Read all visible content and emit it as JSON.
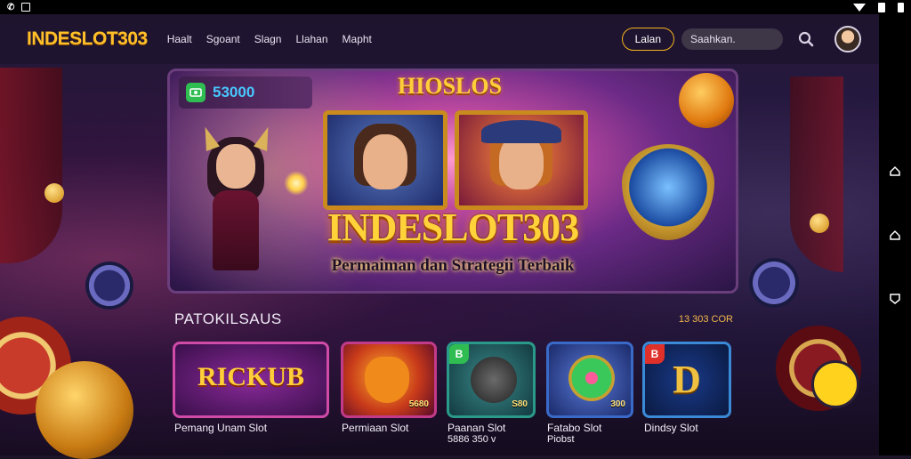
{
  "status_bar": {
    "left_text": "🔔",
    "wifi": "wifi-icon",
    "sim": "sim-icon",
    "battery": "battery-icon"
  },
  "header": {
    "logo": "INDESLOT303",
    "menu": [
      "Haalt",
      "Sgoant",
      "Slagn",
      "Llahan",
      "Mapht"
    ],
    "login_label": "Lalan",
    "search_value": "Saahkan.",
    "search_icon": "search-icon",
    "avatar": "avatar"
  },
  "hero": {
    "badge_value": "53000",
    "top_title": "HIOSLOS",
    "title": "INDESLOT303",
    "subtitle": "Permaiman dan Strategii Terbaik"
  },
  "section": {
    "title": "PATOKILSAUS",
    "meta": "13 303 COR"
  },
  "cards": [
    {
      "art_text": "RICKUB",
      "label": "Pemang Unam Slot",
      "sub": "",
      "tag": "",
      "corner": ""
    },
    {
      "art_text": "",
      "label": "Permiaan Slot",
      "sub": "",
      "tag": "5680",
      "corner": ""
    },
    {
      "art_text": "",
      "label": "Paanan Slot",
      "sub": "5886 350 v",
      "tag": "S80",
      "corner": "B"
    },
    {
      "art_text": "",
      "label": "Fatabo Slot",
      "sub": "Piobst",
      "tag": "300",
      "corner": ""
    },
    {
      "art_text": "D",
      "label": "Dindsy Slot",
      "sub": "",
      "tag": "",
      "corner": "B"
    }
  ],
  "colors": {
    "accent": "#ffc02a",
    "panel": "#1e142e",
    "fab": "#ffd21e"
  },
  "nav": [
    "back-icon",
    "home-icon",
    "recents-icon"
  ]
}
